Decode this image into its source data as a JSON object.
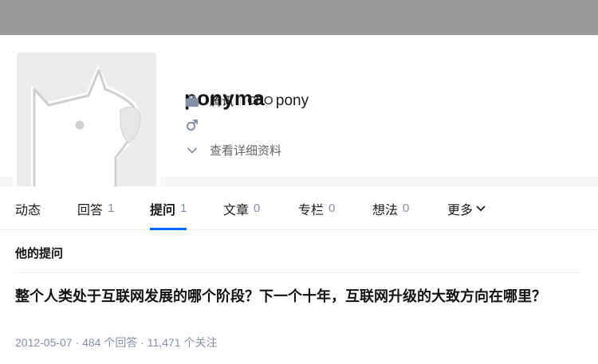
{
  "profile": {
    "username": "ponyma",
    "headline": "pony",
    "company": "腾讯",
    "position": "CEO",
    "gender_icon": "male-icon",
    "more_info_label": "查看详细资料"
  },
  "tabs": [
    {
      "label": "动态",
      "count": ""
    },
    {
      "label": "回答",
      "count": "1"
    },
    {
      "label": "提问",
      "count": "1"
    },
    {
      "label": "文章",
      "count": "0"
    },
    {
      "label": "专栏",
      "count": "0"
    },
    {
      "label": "想法",
      "count": "0"
    },
    {
      "label": "更多",
      "count": ""
    }
  ],
  "active_tab": "提问",
  "section": {
    "title": "他的提问"
  },
  "question": {
    "title": "整个人类处于互联网发展的哪个阶段？下一个十年，互联网升级的大致方向在哪里？",
    "date": "2012-05-07",
    "answers": "484 个回答",
    "followers": "11,471 个关注",
    "meta_separator": " · "
  },
  "colors": {
    "accent": "#0066ff",
    "meta": "#8590a6",
    "cover": "#9a9a9a"
  }
}
